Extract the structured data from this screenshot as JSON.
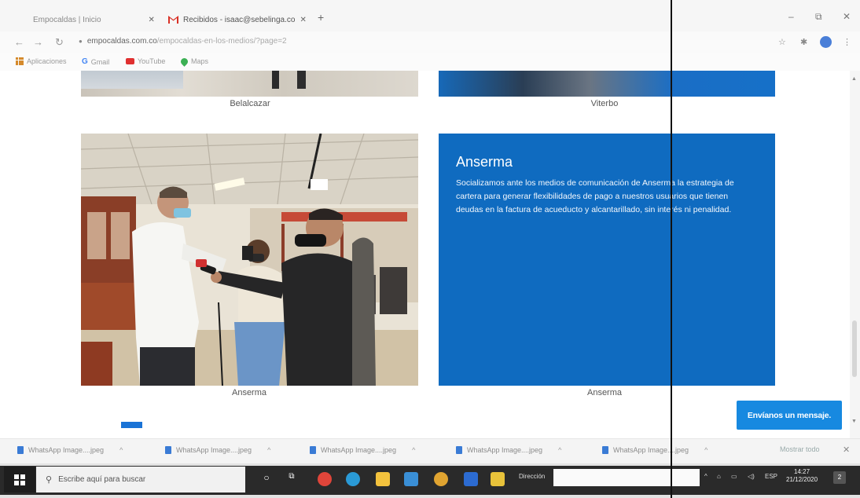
{
  "browser": {
    "tabs": [
      {
        "label": "Empocaldas | Inicio",
        "active": false
      },
      {
        "label": "Recibidos - isaac@sebelinga.co",
        "active": true
      }
    ],
    "new_tab": "+",
    "window_controls": {
      "minimize": "–",
      "maximize": "⧉",
      "close": "✕"
    },
    "url_host": "empocaldas.com.co",
    "url_path": "/empocaldas-en-los-medios/?page=2",
    "bookmarks": [
      "Aplicaciones",
      "Gmail",
      "YouTube",
      "Maps"
    ]
  },
  "gallery": {
    "top_left_caption": "Belalcazar",
    "top_right_caption": "Viterbo",
    "bottom_left_caption": "Anserma",
    "bottom_right_caption": "Anserma",
    "card": {
      "title": "Anserma",
      "text": "Socializamos ante los medios de comunicación de Anserma la estrategia de cartera para generar flexibilidades de pago a nuestros usuarios que tienen deudas en la factura de acueducto y alcantarillado, sin interés ni penalidad."
    }
  },
  "message_button": "Envíanos un mensaje.",
  "downloads": {
    "items": [
      "WhatsApp Image....jpeg",
      "WhatsApp Image....jpeg",
      "WhatsApp Image....jpeg",
      "WhatsApp Image....jpeg",
      "WhatsApp Image....jpeg"
    ],
    "show_all": "Mostrar todo"
  },
  "taskbar": {
    "search_placeholder": "Escribe aquí para buscar",
    "address_label": "Dirección",
    "language": "ESP",
    "time": "14:27",
    "date": "21/12/2020",
    "notification_count": "2"
  },
  "colors": {
    "card_blue": "#0f6bc0",
    "button_blue": "#1789e0",
    "taskbar": "#2a2a2a"
  }
}
